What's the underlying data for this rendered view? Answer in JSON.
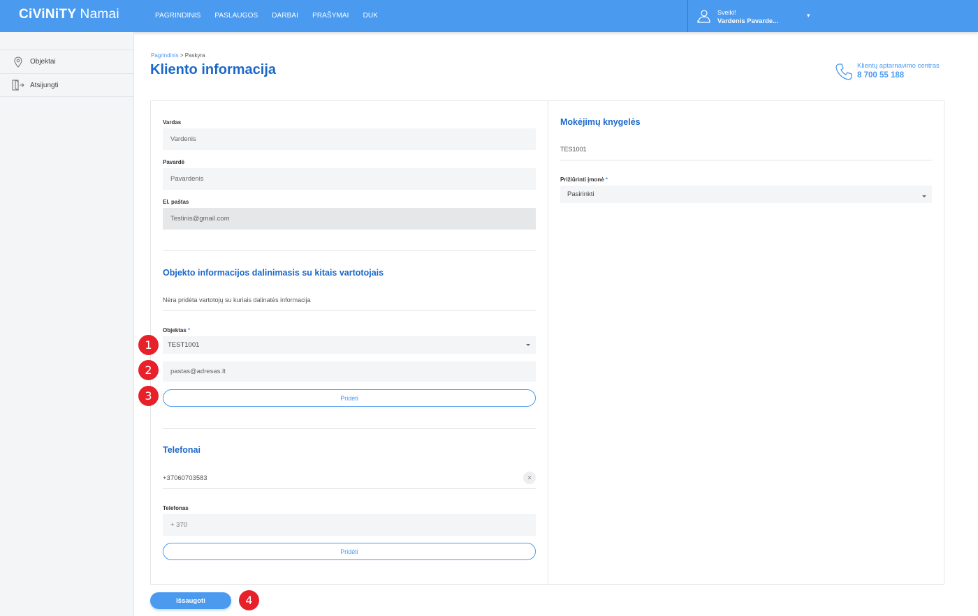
{
  "app": {
    "logo_bold": "CiViNiTY",
    "logo_light": "Namai"
  },
  "nav": {
    "items": [
      "PAGRINDINIS",
      "PASLAUGOS",
      "DARBAI",
      "PRAŠYMAI",
      "DUK"
    ]
  },
  "user": {
    "greeting": "Sveiki!",
    "name": "Vardenis Pavarde...",
    "caret": "▾"
  },
  "sidebar": {
    "items": [
      {
        "label": "Objektai",
        "icon": "location-pin-icon"
      },
      {
        "label": "Atsijungti",
        "icon": "logout-icon"
      }
    ]
  },
  "breadcrumb": {
    "home": "Pagrindinis",
    "separator": ">",
    "current": "Paskyra"
  },
  "page": {
    "title": "Kliento informacija"
  },
  "support": {
    "label": "Klientų aptarnavimo centras",
    "phone": "8 700 55 188"
  },
  "form": {
    "first_name": {
      "label": "Vardas",
      "value": "Vardenis"
    },
    "last_name": {
      "label": "Pavardė",
      "value": "Pavardenis"
    },
    "email": {
      "label": "El. paštas",
      "value": "Testinis@gmail.com"
    }
  },
  "sharing": {
    "title": "Objekto informacijos dalinimasis su kitais vartotojais",
    "empty_text": "Nėra pridėta vartotojų su kuriais dalinatės informacija",
    "object_label": "Objektas",
    "required_mark": "*",
    "object_value": "TEST1001",
    "email_value": "pastas@adresas.lt",
    "add_label": "Pridėti"
  },
  "phones": {
    "title": "Telefonai",
    "existing": "+37060703583",
    "remove_icon": "×",
    "phone_label": "Telefonas",
    "phone_placeholder": "+ 370",
    "add_label": "Pridėti"
  },
  "payment_books": {
    "title": "Mokėjimų knygelės",
    "item": "TES1001",
    "company_label": "Prižiūrinti įmonė",
    "required_mark": "*",
    "company_value": "Pasirinkti"
  },
  "actions": {
    "save_label": "Išsaugoti"
  },
  "badges": [
    "1",
    "2",
    "3",
    "4"
  ],
  "colors": {
    "primary": "#4a9af0",
    "title_blue": "#1b68c9",
    "badge_red": "#e7202a",
    "sidebar_bg": "#f4f5f7"
  }
}
